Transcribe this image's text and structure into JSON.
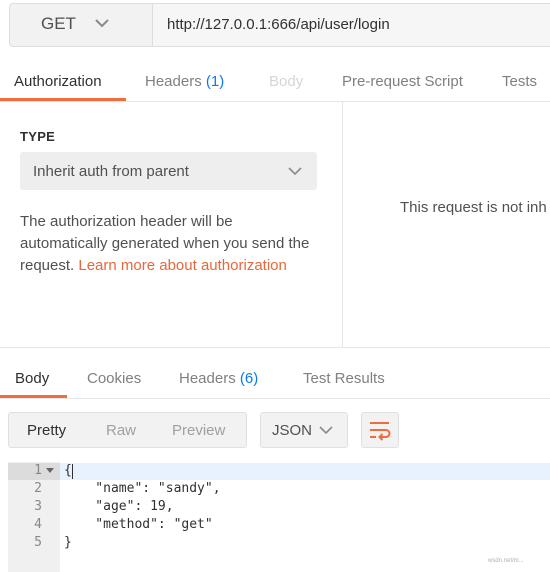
{
  "request": {
    "method": "GET",
    "url": "http://127.0.0.1:666/api/user/login"
  },
  "request_tabs": [
    {
      "label": "Authorization"
    },
    {
      "label": "Headers",
      "count": "(1)"
    },
    {
      "label": "Body"
    },
    {
      "label": "Pre-request Script"
    },
    {
      "label": "Tests"
    }
  ],
  "auth": {
    "type_label": "TYPE",
    "type_value": "Inherit auth from parent",
    "description": "The authorization header will be automatically generated when you send the request.",
    "learn_more": "Learn more about authorization",
    "right_message": "This request is not inh"
  },
  "response_tabs": [
    {
      "label": "Body"
    },
    {
      "label": "Cookies"
    },
    {
      "label": "Headers",
      "count": "(6)"
    },
    {
      "label": "Test Results"
    }
  ],
  "view_modes": [
    "Pretty",
    "Raw",
    "Preview"
  ],
  "format": "JSON",
  "code": {
    "line_numbers": [
      "1",
      "2",
      "3",
      "4",
      "5"
    ],
    "lines": [
      "{",
      "    \"name\": \"sandy\",",
      "    \"age\": 19,",
      "    \"method\": \"get\"",
      "}"
    ]
  },
  "watermark": "wsdn.net/m..."
}
